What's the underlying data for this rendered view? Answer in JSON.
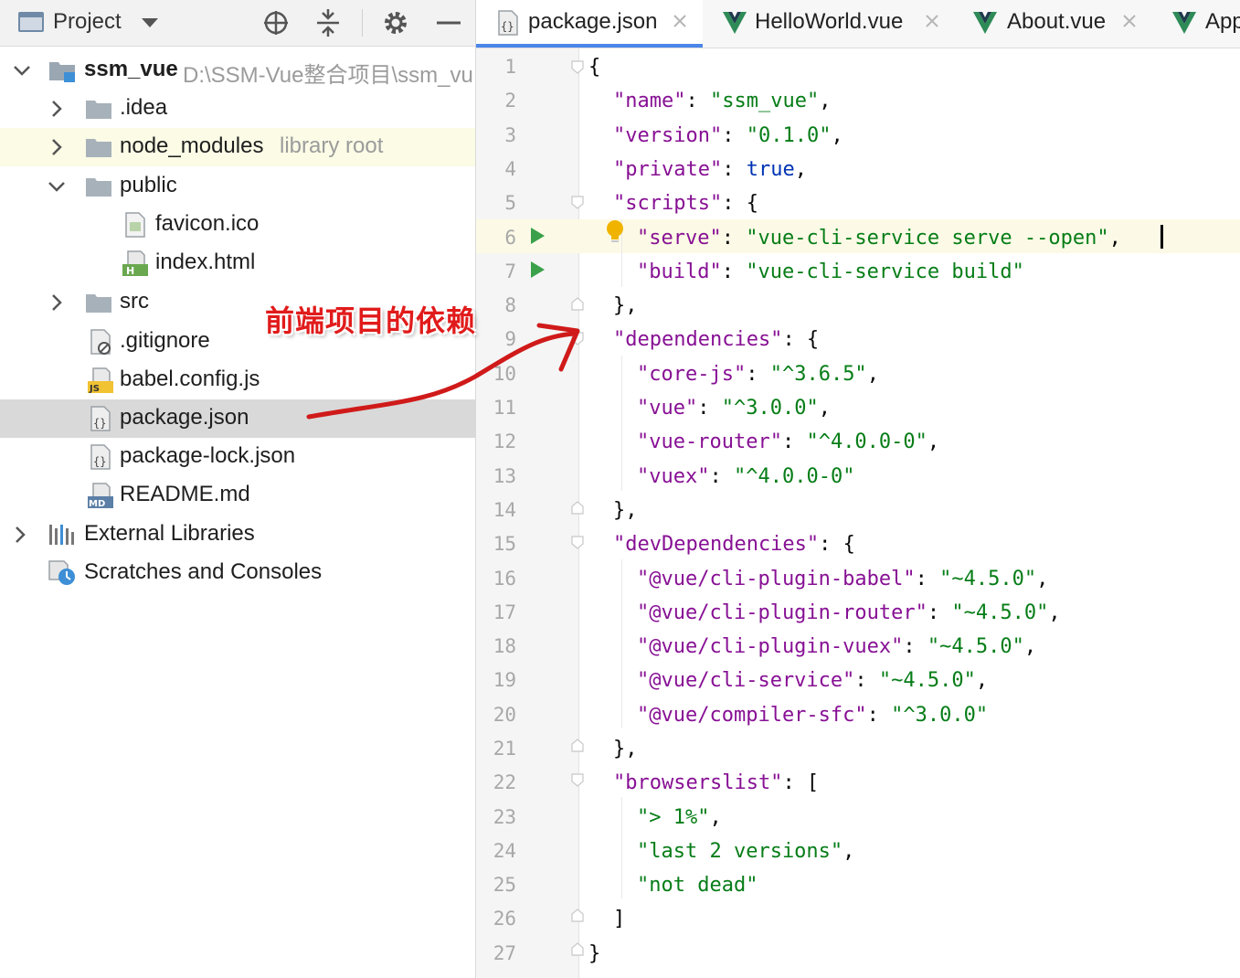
{
  "project_panel": {
    "title": "Project",
    "tree": [
      {
        "label": "ssm_vue",
        "hint": "D:\\SSM-Vue整合项目\\ssm_vu",
        "icon": "module-folder-icon"
      },
      {
        "label": ".idea",
        "icon": "folder-icon"
      },
      {
        "label": "node_modules",
        "hint": "library root",
        "icon": "folder-icon"
      },
      {
        "label": "public",
        "icon": "folder-icon"
      },
      {
        "label": "favicon.ico",
        "icon": "image-file-icon"
      },
      {
        "label": "index.html",
        "icon": "html-file-icon"
      },
      {
        "label": "src",
        "icon": "folder-icon"
      },
      {
        "label": ".gitignore",
        "icon": "gitignore-file-icon"
      },
      {
        "label": "babel.config.js",
        "icon": "js-file-icon"
      },
      {
        "label": "package.json",
        "icon": "json-file-icon"
      },
      {
        "label": "package-lock.json",
        "icon": "json-file-icon"
      },
      {
        "label": "README.md",
        "icon": "markdown-file-icon"
      },
      {
        "label": "External Libraries",
        "icon": "libraries-icon"
      },
      {
        "label": "Scratches and Consoles",
        "icon": "scratches-icon"
      }
    ]
  },
  "tabs": [
    {
      "label": "package.json",
      "icon": "json-file-icon",
      "active": true
    },
    {
      "label": "HelloWorld.vue",
      "icon": "vue-icon"
    },
    {
      "label": "About.vue",
      "icon": "vue-icon"
    },
    {
      "label": "App",
      "icon": "vue-icon"
    }
  ],
  "editor": {
    "line_numbers": [
      "1",
      "2",
      "3",
      "4",
      "5",
      "6",
      "7",
      "8",
      "9",
      "10",
      "11",
      "12",
      "13",
      "14",
      "15",
      "16",
      "17",
      "18",
      "19",
      "20",
      "21",
      "22",
      "23",
      "24",
      "25",
      "26",
      "27"
    ],
    "lines": [
      [
        {
          "t": "{",
          "c": "p"
        }
      ],
      [
        {
          "t": "\"name\"",
          "c": "k"
        },
        {
          "t": ": ",
          "c": "p"
        },
        {
          "t": "\"ssm_vue\"",
          "c": "s"
        },
        {
          "t": ",",
          "c": "p"
        }
      ],
      [
        {
          "t": "\"version\"",
          "c": "k"
        },
        {
          "t": ": ",
          "c": "p"
        },
        {
          "t": "\"0.1.0\"",
          "c": "s"
        },
        {
          "t": ",",
          "c": "p"
        }
      ],
      [
        {
          "t": "\"private\"",
          "c": "k"
        },
        {
          "t": ": ",
          "c": "p"
        },
        {
          "t": "true",
          "c": "b"
        },
        {
          "t": ",",
          "c": "p"
        }
      ],
      [
        {
          "t": "\"scripts\"",
          "c": "k"
        },
        {
          "t": ": {",
          "c": "p"
        }
      ],
      [
        {
          "t": "\"serve\"",
          "c": "k"
        },
        {
          "t": ": ",
          "c": "p"
        },
        {
          "t": "\"vue-cli-service serve --open\"",
          "c": "s"
        },
        {
          "t": ",",
          "c": "p"
        }
      ],
      [
        {
          "t": "\"build\"",
          "c": "k"
        },
        {
          "t": ": ",
          "c": "p"
        },
        {
          "t": "\"vue-cli-service build\"",
          "c": "s"
        }
      ],
      [
        {
          "t": "},",
          "c": "p"
        }
      ],
      [
        {
          "t": "\"dependencies\"",
          "c": "k"
        },
        {
          "t": ": {",
          "c": "p"
        }
      ],
      [
        {
          "t": "\"core-js\"",
          "c": "k"
        },
        {
          "t": ": ",
          "c": "p"
        },
        {
          "t": "\"^3.6.5\"",
          "c": "s"
        },
        {
          "t": ",",
          "c": "p"
        }
      ],
      [
        {
          "t": "\"vue\"",
          "c": "k"
        },
        {
          "t": ": ",
          "c": "p"
        },
        {
          "t": "\"^3.0.0\"",
          "c": "s"
        },
        {
          "t": ",",
          "c": "p"
        }
      ],
      [
        {
          "t": "\"vue-router\"",
          "c": "k"
        },
        {
          "t": ": ",
          "c": "p"
        },
        {
          "t": "\"^4.0.0-0\"",
          "c": "s"
        },
        {
          "t": ",",
          "c": "p"
        }
      ],
      [
        {
          "t": "\"vuex\"",
          "c": "k"
        },
        {
          "t": ": ",
          "c": "p"
        },
        {
          "t": "\"^4.0.0-0\"",
          "c": "s"
        }
      ],
      [
        {
          "t": "},",
          "c": "p"
        }
      ],
      [
        {
          "t": "\"devDependencies\"",
          "c": "k"
        },
        {
          "t": ": {",
          "c": "p"
        }
      ],
      [
        {
          "t": "\"@vue/cli-plugin-babel\"",
          "c": "k"
        },
        {
          "t": ": ",
          "c": "p"
        },
        {
          "t": "\"~4.5.0\"",
          "c": "s"
        },
        {
          "t": ",",
          "c": "p"
        }
      ],
      [
        {
          "t": "\"@vue/cli-plugin-router\"",
          "c": "k"
        },
        {
          "t": ": ",
          "c": "p"
        },
        {
          "t": "\"~4.5.0\"",
          "c": "s"
        },
        {
          "t": ",",
          "c": "p"
        }
      ],
      [
        {
          "t": "\"@vue/cli-plugin-vuex\"",
          "c": "k"
        },
        {
          "t": ": ",
          "c": "p"
        },
        {
          "t": "\"~4.5.0\"",
          "c": "s"
        },
        {
          "t": ",",
          "c": "p"
        }
      ],
      [
        {
          "t": "\"@vue/cli-service\"",
          "c": "k"
        },
        {
          "t": ": ",
          "c": "p"
        },
        {
          "t": "\"~4.5.0\"",
          "c": "s"
        },
        {
          "t": ",",
          "c": "p"
        }
      ],
      [
        {
          "t": "\"@vue/compiler-sfc\"",
          "c": "k"
        },
        {
          "t": ": ",
          "c": "p"
        },
        {
          "t": "\"^3.0.0\"",
          "c": "s"
        }
      ],
      [
        {
          "t": "},",
          "c": "p"
        }
      ],
      [
        {
          "t": "\"browserslist\"",
          "c": "k"
        },
        {
          "t": ": [",
          "c": "p"
        }
      ],
      [
        {
          "t": "\"> 1%\"",
          "c": "s"
        },
        {
          "t": ",",
          "c": "p"
        }
      ],
      [
        {
          "t": "\"last 2 versions\"",
          "c": "s"
        },
        {
          "t": ",",
          "c": "p"
        }
      ],
      [
        {
          "t": "\"not dead\"",
          "c": "s"
        }
      ],
      [
        {
          "t": "]",
          "c": "p"
        }
      ],
      [
        {
          "t": "}",
          "c": "p"
        }
      ]
    ]
  },
  "annotation": {
    "text": "前端项目的依赖"
  },
  "colors": {
    "accent": "#4a86e8",
    "string": "#067d17",
    "key": "#871094",
    "keyword": "#0033b3",
    "annotation": "#e11b1b"
  }
}
